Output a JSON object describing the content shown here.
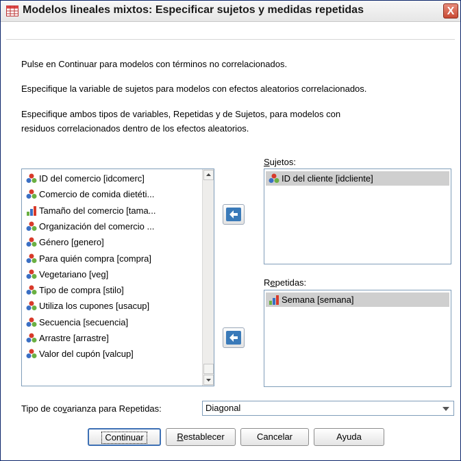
{
  "window": {
    "title": "Modelos lineales mixtos: Especificar sujetos y medidas repetidas",
    "close_label": "X"
  },
  "instructions": {
    "line1": "Pulse en Continuar para modelos con términos no correlacionados.",
    "line2": "Especifique la variable de sujetos para modelos con efectos aleatorios correlacionados.",
    "line3a": "Especifique ambos tipos de variables, Repetidas y de Sujetos, para modelos con",
    "line3b": "residuos correlacionados dentro de los efectos aleatorios."
  },
  "variables": {
    "items": [
      {
        "label": "ID del comercio [idcomerc]",
        "icon": "nominal-icon"
      },
      {
        "label": "Comercio de comida dietéti...",
        "icon": "nominal-icon"
      },
      {
        "label": "Tamaño del comercio [tama...",
        "icon": "ordinal-icon"
      },
      {
        "label": "Organización del comercio ...",
        "icon": "nominal-icon"
      },
      {
        "label": "Género [genero]",
        "icon": "nominal-icon"
      },
      {
        "label": "Para quién compra [compra]",
        "icon": "nominal-icon"
      },
      {
        "label": "Vegetariano [veg]",
        "icon": "nominal-icon"
      },
      {
        "label": "Tipo de compra [stilo]",
        "icon": "nominal-icon"
      },
      {
        "label": "Utiliza los cupones [usacup]",
        "icon": "nominal-icon"
      },
      {
        "label": "Secuencia [secuencia]",
        "icon": "nominal-icon"
      },
      {
        "label": "Arrastre [arrastre]",
        "icon": "nominal-icon"
      },
      {
        "label": "Valor del cupón [valcup]",
        "icon": "nominal-icon"
      }
    ]
  },
  "subjects": {
    "label_prefix": "",
    "label_mnemonic": "S",
    "label_rest": "ujetos:",
    "items": [
      {
        "label": "ID del cliente [idcliente]",
        "icon": "nominal-icon"
      }
    ]
  },
  "repeated": {
    "label_prefix": "R",
    "label_mnemonic": "e",
    "label_rest": "petidas:",
    "items": [
      {
        "label": "Semana [semana]",
        "icon": "ordinal-icon"
      }
    ]
  },
  "covariance": {
    "label_prefix": "Tipo de co",
    "label_mnemonic": "v",
    "label_rest": "arianza para Repetidas:",
    "selected": "Diagonal"
  },
  "buttons": {
    "continue": {
      "mn": "",
      "rest": "Continuar"
    },
    "reset": {
      "mn": "R",
      "rest": "establecer"
    },
    "cancel": "Cancelar",
    "help": "Ayuda"
  }
}
